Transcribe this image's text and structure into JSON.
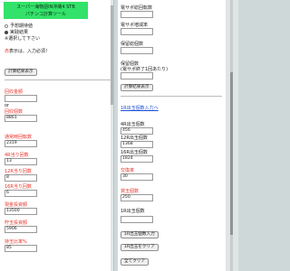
{
  "left": {
    "banner_line1": "スーパー海物語IN沖縄4 STB",
    "banner_line2": "パチンコ計算ツール",
    "radio_expected": "予想期待値",
    "radio_actual": "実践結果",
    "radio_hint": "※選択して下さい",
    "note_prefix": "赤",
    "note_suffix": "表示は、入力必須！",
    "calc_button": "計算結果表示",
    "fields": [
      {
        "label": "回収金額",
        "value": "",
        "red": true
      },
      {
        "label": "回収個数",
        "value": "8861",
        "red": true,
        "or": "or"
      },
      {
        "label": "通常時回転数",
        "value": "2319",
        "red": true
      },
      {
        "label": "4R当り回数",
        "value": "13",
        "red": true
      },
      {
        "label": "12R当り回数",
        "value": "8",
        "red": true
      },
      {
        "label": "16R当り回数",
        "value": "6",
        "red": true
      },
      {
        "label": "現金投資額",
        "value": "13500",
        "red": true
      },
      {
        "label": "貯玉投資額",
        "value": "5906",
        "red": true
      },
      {
        "label": "持玉比率%",
        "value": "85",
        "red": true
      }
    ]
  },
  "right": {
    "top_label1": "電サポ総回転数",
    "top_label2": "電サポ増減率",
    "top_label3": "保留総個数",
    "top_label4": "保留個数",
    "top_label4b": "(電サポ終了1回あたり)",
    "calc_button": "計算結果表示",
    "link_text": "1R出玉個数入力へ",
    "section_label": "4R出玉個数",
    "rows": [
      {
        "label": "4R出玉個数",
        "value": "456"
      },
      {
        "label": "12R出玉個数",
        "value": "1368"
      },
      {
        "label": "16R出玉個数",
        "value": "1824"
      }
    ],
    "exchange_label": "交換率",
    "exchange_value": "30",
    "borrow_label": "貸玉個数",
    "borrow_value": "250",
    "r1_label": "1R出玉個数",
    "r1_value": "",
    "btn_input": "1R出玉個数入力",
    "btn_clear": "1R出玉をクリア",
    "btn_all_clear": "全てクリア"
  }
}
